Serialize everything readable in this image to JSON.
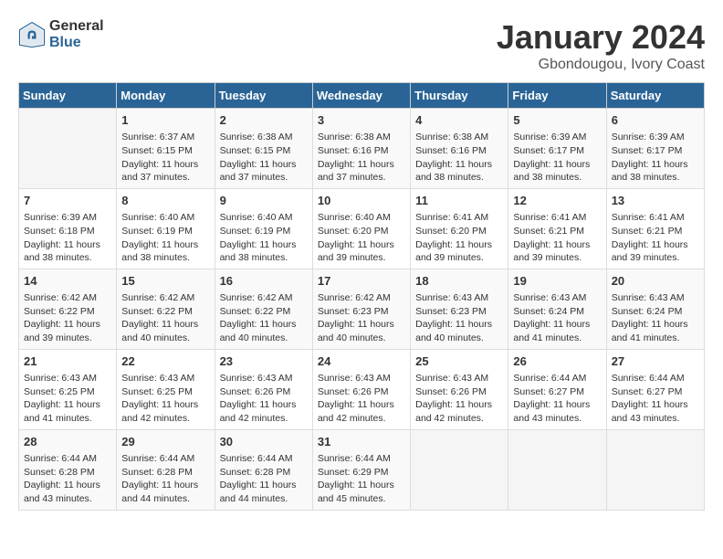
{
  "logo": {
    "general": "General",
    "blue": "Blue"
  },
  "title": "January 2024",
  "location": "Gbondougou, Ivory Coast",
  "weekdays": [
    "Sunday",
    "Monday",
    "Tuesday",
    "Wednesday",
    "Thursday",
    "Friday",
    "Saturday"
  ],
  "weeks": [
    [
      {
        "day": "",
        "info": ""
      },
      {
        "day": "1",
        "info": "Sunrise: 6:37 AM\nSunset: 6:15 PM\nDaylight: 11 hours\nand 37 minutes."
      },
      {
        "day": "2",
        "info": "Sunrise: 6:38 AM\nSunset: 6:15 PM\nDaylight: 11 hours\nand 37 minutes."
      },
      {
        "day": "3",
        "info": "Sunrise: 6:38 AM\nSunset: 6:16 PM\nDaylight: 11 hours\nand 37 minutes."
      },
      {
        "day": "4",
        "info": "Sunrise: 6:38 AM\nSunset: 6:16 PM\nDaylight: 11 hours\nand 38 minutes."
      },
      {
        "day": "5",
        "info": "Sunrise: 6:39 AM\nSunset: 6:17 PM\nDaylight: 11 hours\nand 38 minutes."
      },
      {
        "day": "6",
        "info": "Sunrise: 6:39 AM\nSunset: 6:17 PM\nDaylight: 11 hours\nand 38 minutes."
      }
    ],
    [
      {
        "day": "7",
        "info": "Sunrise: 6:39 AM\nSunset: 6:18 PM\nDaylight: 11 hours\nand 38 minutes."
      },
      {
        "day": "8",
        "info": "Sunrise: 6:40 AM\nSunset: 6:19 PM\nDaylight: 11 hours\nand 38 minutes."
      },
      {
        "day": "9",
        "info": "Sunrise: 6:40 AM\nSunset: 6:19 PM\nDaylight: 11 hours\nand 38 minutes."
      },
      {
        "day": "10",
        "info": "Sunrise: 6:40 AM\nSunset: 6:20 PM\nDaylight: 11 hours\nand 39 minutes."
      },
      {
        "day": "11",
        "info": "Sunrise: 6:41 AM\nSunset: 6:20 PM\nDaylight: 11 hours\nand 39 minutes."
      },
      {
        "day": "12",
        "info": "Sunrise: 6:41 AM\nSunset: 6:21 PM\nDaylight: 11 hours\nand 39 minutes."
      },
      {
        "day": "13",
        "info": "Sunrise: 6:41 AM\nSunset: 6:21 PM\nDaylight: 11 hours\nand 39 minutes."
      }
    ],
    [
      {
        "day": "14",
        "info": "Sunrise: 6:42 AM\nSunset: 6:22 PM\nDaylight: 11 hours\nand 39 minutes."
      },
      {
        "day": "15",
        "info": "Sunrise: 6:42 AM\nSunset: 6:22 PM\nDaylight: 11 hours\nand 40 minutes."
      },
      {
        "day": "16",
        "info": "Sunrise: 6:42 AM\nSunset: 6:22 PM\nDaylight: 11 hours\nand 40 minutes."
      },
      {
        "day": "17",
        "info": "Sunrise: 6:42 AM\nSunset: 6:23 PM\nDaylight: 11 hours\nand 40 minutes."
      },
      {
        "day": "18",
        "info": "Sunrise: 6:43 AM\nSunset: 6:23 PM\nDaylight: 11 hours\nand 40 minutes."
      },
      {
        "day": "19",
        "info": "Sunrise: 6:43 AM\nSunset: 6:24 PM\nDaylight: 11 hours\nand 41 minutes."
      },
      {
        "day": "20",
        "info": "Sunrise: 6:43 AM\nSunset: 6:24 PM\nDaylight: 11 hours\nand 41 minutes."
      }
    ],
    [
      {
        "day": "21",
        "info": "Sunrise: 6:43 AM\nSunset: 6:25 PM\nDaylight: 11 hours\nand 41 minutes."
      },
      {
        "day": "22",
        "info": "Sunrise: 6:43 AM\nSunset: 6:25 PM\nDaylight: 11 hours\nand 42 minutes."
      },
      {
        "day": "23",
        "info": "Sunrise: 6:43 AM\nSunset: 6:26 PM\nDaylight: 11 hours\nand 42 minutes."
      },
      {
        "day": "24",
        "info": "Sunrise: 6:43 AM\nSunset: 6:26 PM\nDaylight: 11 hours\nand 42 minutes."
      },
      {
        "day": "25",
        "info": "Sunrise: 6:43 AM\nSunset: 6:26 PM\nDaylight: 11 hours\nand 42 minutes."
      },
      {
        "day": "26",
        "info": "Sunrise: 6:44 AM\nSunset: 6:27 PM\nDaylight: 11 hours\nand 43 minutes."
      },
      {
        "day": "27",
        "info": "Sunrise: 6:44 AM\nSunset: 6:27 PM\nDaylight: 11 hours\nand 43 minutes."
      }
    ],
    [
      {
        "day": "28",
        "info": "Sunrise: 6:44 AM\nSunset: 6:28 PM\nDaylight: 11 hours\nand 43 minutes."
      },
      {
        "day": "29",
        "info": "Sunrise: 6:44 AM\nSunset: 6:28 PM\nDaylight: 11 hours\nand 44 minutes."
      },
      {
        "day": "30",
        "info": "Sunrise: 6:44 AM\nSunset: 6:28 PM\nDaylight: 11 hours\nand 44 minutes."
      },
      {
        "day": "31",
        "info": "Sunrise: 6:44 AM\nSunset: 6:29 PM\nDaylight: 11 hours\nand 45 minutes."
      },
      {
        "day": "",
        "info": ""
      },
      {
        "day": "",
        "info": ""
      },
      {
        "day": "",
        "info": ""
      }
    ]
  ]
}
